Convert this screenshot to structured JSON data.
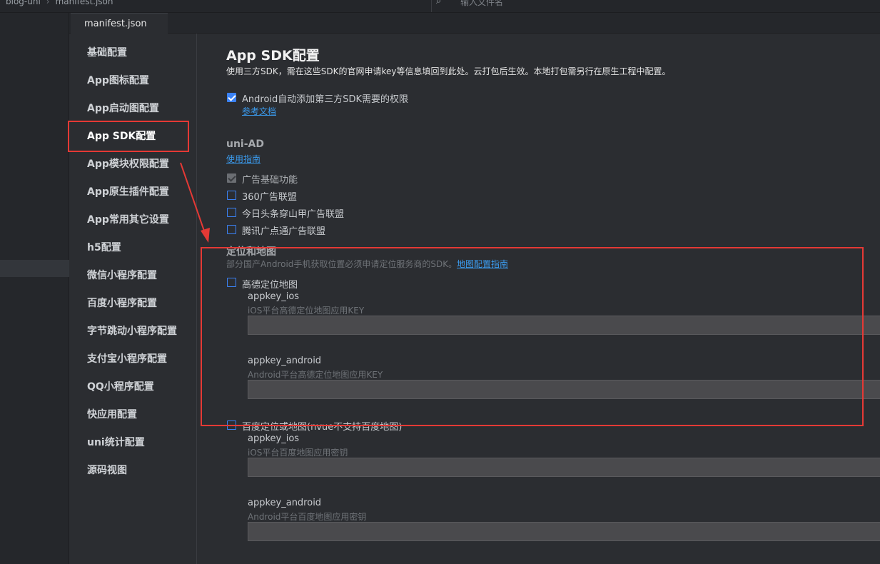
{
  "breadcrumb": {
    "project": "blog-uni",
    "file": "manifest.json"
  },
  "search": {
    "placeholder": "输入文件名",
    "icon": "search-file-icon"
  },
  "tabs": [
    {
      "label": "manifest.json"
    }
  ],
  "nav": {
    "items": [
      {
        "label": "基础配置"
      },
      {
        "label": "App图标配置"
      },
      {
        "label": "App启动图配置"
      },
      {
        "label": "App SDK配置",
        "active": true
      },
      {
        "label": "App模块权限配置"
      },
      {
        "label": "App原生插件配置"
      },
      {
        "label": "App常用其它设置"
      },
      {
        "label": "h5配置"
      },
      {
        "label": "微信小程序配置"
      },
      {
        "label": "百度小程序配置"
      },
      {
        "label": "字节跳动小程序配置"
      },
      {
        "label": "支付宝小程序配置"
      },
      {
        "label": "QQ小程序配置"
      },
      {
        "label": "快应用配置"
      },
      {
        "label": "uni统计配置"
      },
      {
        "label": "源码视图"
      }
    ]
  },
  "main": {
    "title": "App SDK配置",
    "description": "使用三方SDK，需在这些SDK的官网申请key等信息填回到此处。云打包后生效。本地打包需另行在原生工程中配置。",
    "android_permission": {
      "label": "Android自动添加第三方SDK需要的权限",
      "checked": true,
      "link": "参考文档"
    },
    "uniad": {
      "title": "uni-AD",
      "link": "使用指南",
      "options": [
        {
          "label": "广告基础功能",
          "checked": true,
          "disabled": true
        },
        {
          "label": "360广告联盟",
          "checked": false
        },
        {
          "label": "今日头条穿山甲广告联盟",
          "checked": false
        },
        {
          "label": "腾讯广点通广告联盟",
          "checked": false
        }
      ]
    },
    "maps": {
      "title": "定位和地图",
      "note": "部分国产Android手机获取位置必须申请定位服务商的SDK。",
      "link": "地图配置指南",
      "amap": {
        "label": "高德定位地图",
        "checked": false,
        "ios_title": "appkey_ios",
        "ios_note": "iOS平台高德定位地图应用KEY",
        "ios_value": "",
        "android_title": "appkey_android",
        "android_note": "Android平台高德定位地图应用KEY",
        "android_value": ""
      },
      "baidu": {
        "label": "百度定位或地图(nvue不支持百度地图)",
        "checked": false,
        "ios_title": "appkey_ios",
        "ios_note": "iOS平台百度地图应用密钥",
        "ios_value": "",
        "android_title": "appkey_android",
        "android_note": "Android平台百度地图应用密钥",
        "android_value": ""
      }
    }
  },
  "colors": {
    "accent": "#3b82f6",
    "link": "#3b9cf0",
    "annotation": "#e53935",
    "background": "#2b2d31"
  }
}
